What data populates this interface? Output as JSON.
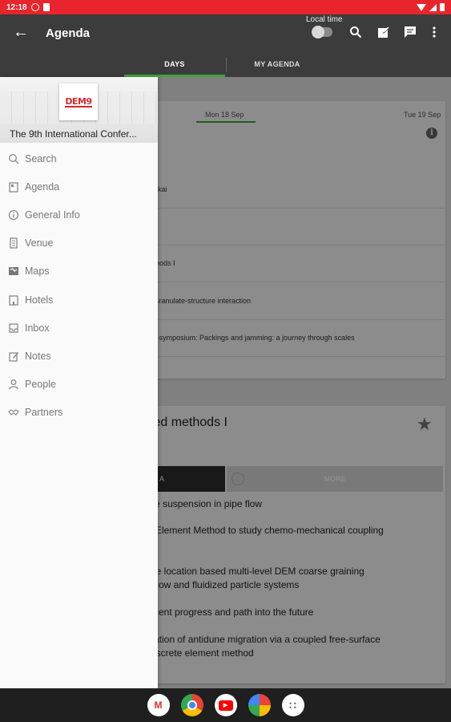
{
  "status_bar": {
    "time": "12:18"
  },
  "app_bar": {
    "title": "Agenda",
    "local_time_label": "Local time",
    "icons": [
      "back-icon",
      "search-icon",
      "edit-icon",
      "chat-icon",
      "more-vert-icon"
    ]
  },
  "tabs": [
    {
      "label": "DAYS",
      "selected": true
    },
    {
      "label": "MY AGENDA",
      "selected": false
    }
  ],
  "drawer": {
    "logo_text": "DEM9",
    "conference_title": "The 9th International Confer...",
    "items": [
      {
        "label": "Search",
        "icon": "search-icon"
      },
      {
        "label": "Agenda",
        "icon": "agenda-icon"
      },
      {
        "label": "General Info",
        "icon": "info-icon"
      },
      {
        "label": "Venue",
        "icon": "building-icon"
      },
      {
        "label": "Maps",
        "icon": "map-icon"
      },
      {
        "label": "Hotels",
        "icon": "hotel-icon"
      },
      {
        "label": "Inbox",
        "icon": "inbox-icon"
      },
      {
        "label": "Notes",
        "icon": "notes-icon"
      },
      {
        "label": "People",
        "icon": "person-icon"
      },
      {
        "label": "Partners",
        "icon": "handshake-icon"
      }
    ]
  },
  "days": {
    "selected": "Mon 18 Sep",
    "next": "Tue 19 Sep"
  },
  "sessions": [
    "s Sakai",
    "eak",
    "methods I",
    "m: Granulate-structure interaction",
    "Mini-symposium: Packings and jamming: a journey through scales"
  ],
  "detail": {
    "title": "pled methods I",
    "segment_left": "A",
    "segment_right": "MORE",
    "talks": [
      [
        "ute suspension in pipe flow"
      ],
      [
        "Element Method to study chemo-mechanical coupling"
      ],
      [
        "le location based multi-level DEM coarse graining",
        "flow and fluidized particle systems"
      ],
      [
        "cent progress and path into the future"
      ],
      [
        "ation of antidune migration via a coupled free-surface",
        "iscrete element method"
      ]
    ]
  },
  "nav_apps": [
    {
      "name": "gmail-icon",
      "glyph": "M",
      "color": "#d93025"
    },
    {
      "name": "chrome-icon",
      "glyph": "●",
      "color": "#1a73e8"
    },
    {
      "name": "youtube-icon",
      "glyph": "▶",
      "color": "#ff0000"
    },
    {
      "name": "photos-icon",
      "glyph": "✹",
      "color": "#34a853"
    },
    {
      "name": "app-drawer-icon",
      "glyph": "∷",
      "color": "#5f6368"
    }
  ]
}
